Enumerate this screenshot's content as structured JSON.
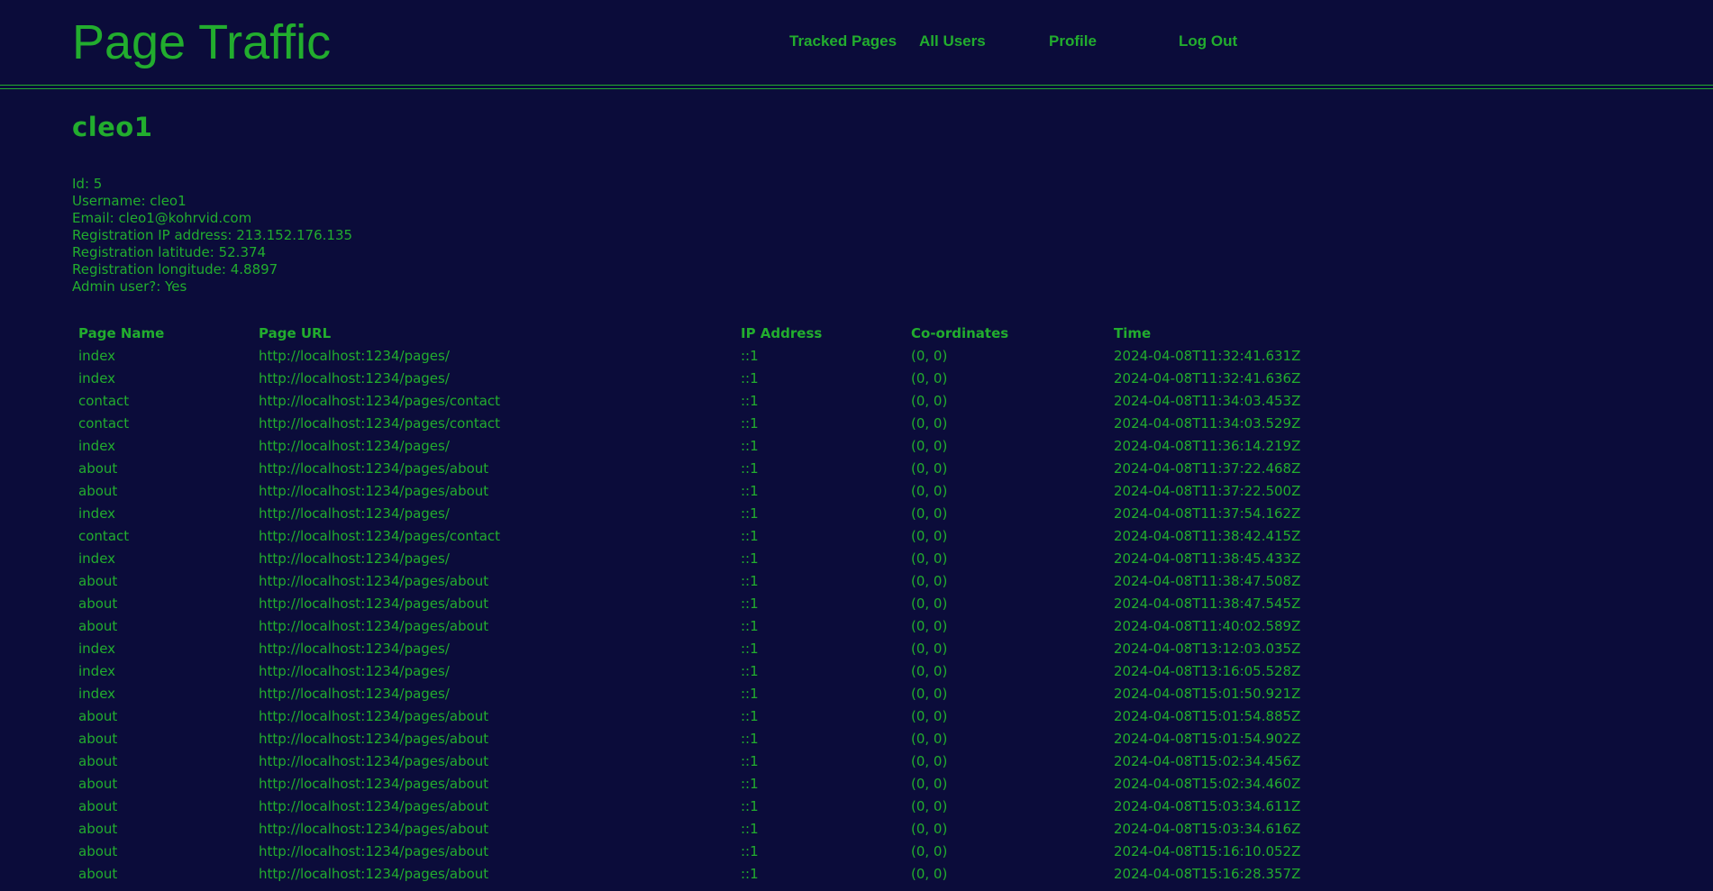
{
  "header": {
    "title": "Page Traffic",
    "nav": {
      "tracked_pages": "Tracked Pages",
      "all_users": "All Users",
      "profile": "Profile",
      "log_out": "Log Out"
    }
  },
  "user": {
    "name": "cleo1",
    "details": [
      "Id: 5",
      "Username: cleo1",
      "Email: cleo1@kohrvid.com",
      "Registration IP address: 213.152.176.135",
      "Registration latitude: 52.374",
      "Registration longitude: 4.8897",
      "Admin user?: Yes"
    ]
  },
  "table": {
    "columns": [
      "Page Name",
      "Page URL",
      "IP Address",
      "Co-ordinates",
      "Time"
    ],
    "rows": [
      [
        "index",
        "http://localhost:1234/pages/",
        "::1",
        "(0, 0)",
        "2024-04-08T11:32:41.631Z"
      ],
      [
        "index",
        "http://localhost:1234/pages/",
        "::1",
        "(0, 0)",
        "2024-04-08T11:32:41.636Z"
      ],
      [
        "contact",
        "http://localhost:1234/pages/contact",
        "::1",
        "(0, 0)",
        "2024-04-08T11:34:03.453Z"
      ],
      [
        "contact",
        "http://localhost:1234/pages/contact",
        "::1",
        "(0, 0)",
        "2024-04-08T11:34:03.529Z"
      ],
      [
        "index",
        "http://localhost:1234/pages/",
        "::1",
        "(0, 0)",
        "2024-04-08T11:36:14.219Z"
      ],
      [
        "about",
        "http://localhost:1234/pages/about",
        "::1",
        "(0, 0)",
        "2024-04-08T11:37:22.468Z"
      ],
      [
        "about",
        "http://localhost:1234/pages/about",
        "::1",
        "(0, 0)",
        "2024-04-08T11:37:22.500Z"
      ],
      [
        "index",
        "http://localhost:1234/pages/",
        "::1",
        "(0, 0)",
        "2024-04-08T11:37:54.162Z"
      ],
      [
        "contact",
        "http://localhost:1234/pages/contact",
        "::1",
        "(0, 0)",
        "2024-04-08T11:38:42.415Z"
      ],
      [
        "index",
        "http://localhost:1234/pages/",
        "::1",
        "(0, 0)",
        "2024-04-08T11:38:45.433Z"
      ],
      [
        "about",
        "http://localhost:1234/pages/about",
        "::1",
        "(0, 0)",
        "2024-04-08T11:38:47.508Z"
      ],
      [
        "about",
        "http://localhost:1234/pages/about",
        "::1",
        "(0, 0)",
        "2024-04-08T11:38:47.545Z"
      ],
      [
        "about",
        "http://localhost:1234/pages/about",
        "::1",
        "(0, 0)",
        "2024-04-08T11:40:02.589Z"
      ],
      [
        "index",
        "http://localhost:1234/pages/",
        "::1",
        "(0, 0)",
        "2024-04-08T13:12:03.035Z"
      ],
      [
        "index",
        "http://localhost:1234/pages/",
        "::1",
        "(0, 0)",
        "2024-04-08T13:16:05.528Z"
      ],
      [
        "index",
        "http://localhost:1234/pages/",
        "::1",
        "(0, 0)",
        "2024-04-08T15:01:50.921Z"
      ],
      [
        "about",
        "http://localhost:1234/pages/about",
        "::1",
        "(0, 0)",
        "2024-04-08T15:01:54.885Z"
      ],
      [
        "about",
        "http://localhost:1234/pages/about",
        "::1",
        "(0, 0)",
        "2024-04-08T15:01:54.902Z"
      ],
      [
        "about",
        "http://localhost:1234/pages/about",
        "::1",
        "(0, 0)",
        "2024-04-08T15:02:34.456Z"
      ],
      [
        "about",
        "http://localhost:1234/pages/about",
        "::1",
        "(0, 0)",
        "2024-04-08T15:02:34.460Z"
      ],
      [
        "about",
        "http://localhost:1234/pages/about",
        "::1",
        "(0, 0)",
        "2024-04-08T15:03:34.611Z"
      ],
      [
        "about",
        "http://localhost:1234/pages/about",
        "::1",
        "(0, 0)",
        "2024-04-08T15:03:34.616Z"
      ],
      [
        "about",
        "http://localhost:1234/pages/about",
        "::1",
        "(0, 0)",
        "2024-04-08T15:16:10.052Z"
      ],
      [
        "about",
        "http://localhost:1234/pages/about",
        "::1",
        "(0, 0)",
        "2024-04-08T15:16:28.357Z"
      ]
    ]
  },
  "colors": {
    "background": "#0b0c3a",
    "accent": "#22ad2e"
  }
}
